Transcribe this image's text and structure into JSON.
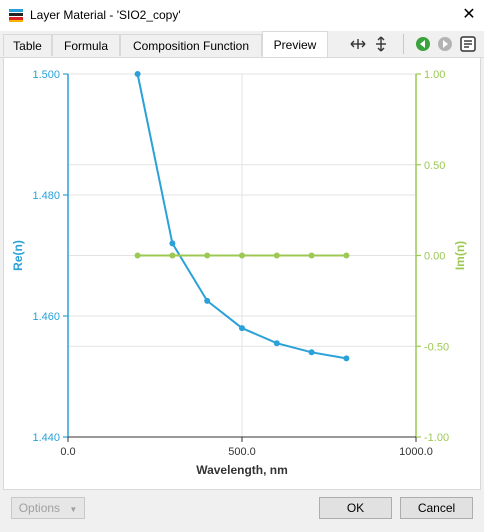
{
  "window": {
    "title": "Layer Material - 'SIO2_copy'",
    "close_glyph": "✕"
  },
  "tabs": [
    {
      "label": "Table"
    },
    {
      "label": "Formula"
    },
    {
      "label": "Composition Function"
    },
    {
      "label": "Preview",
      "active": true
    }
  ],
  "toolbar": {
    "icons": [
      "fit-horizontal-icon",
      "fit-vertical-icon",
      "back-arrow-icon",
      "forward-arrow-icon",
      "settings-icon"
    ]
  },
  "buttons": {
    "options": "Options",
    "ok": "OK",
    "cancel": "Cancel"
  },
  "colors": {
    "re_series": "#2aa1d8",
    "im_series": "#9cc954",
    "grid": "#e3e3e3"
  },
  "chart_data": {
    "type": "line",
    "xlabel": "Wavelength, nm",
    "ylabel_left": "Re(n)",
    "ylabel_right": "Im(n)",
    "xlim": [
      0,
      1000
    ],
    "ylim_left": [
      1.44,
      1.5
    ],
    "ylim_right": [
      -1.0,
      1.0
    ],
    "x_ticks": [
      "0.0",
      "500.0",
      "1000.0"
    ],
    "y_left_ticks": [
      "1.440",
      "1.460",
      "1.480",
      "1.500"
    ],
    "y_right_ticks": [
      "-1.00",
      "-0.50",
      "0.00",
      "0.50",
      "1.00"
    ],
    "grid": true,
    "series": [
      {
        "name": "Re(n)",
        "axis": "left",
        "x": [
          200,
          300,
          400,
          500,
          600,
          700,
          800
        ],
        "values": [
          1.5,
          1.472,
          1.4625,
          1.458,
          1.4555,
          1.454,
          1.453
        ]
      },
      {
        "name": "Im(n)",
        "axis": "right",
        "x": [
          200,
          300,
          400,
          500,
          600,
          700,
          800
        ],
        "values": [
          0,
          0,
          0,
          0,
          0,
          0,
          0
        ]
      }
    ]
  }
}
